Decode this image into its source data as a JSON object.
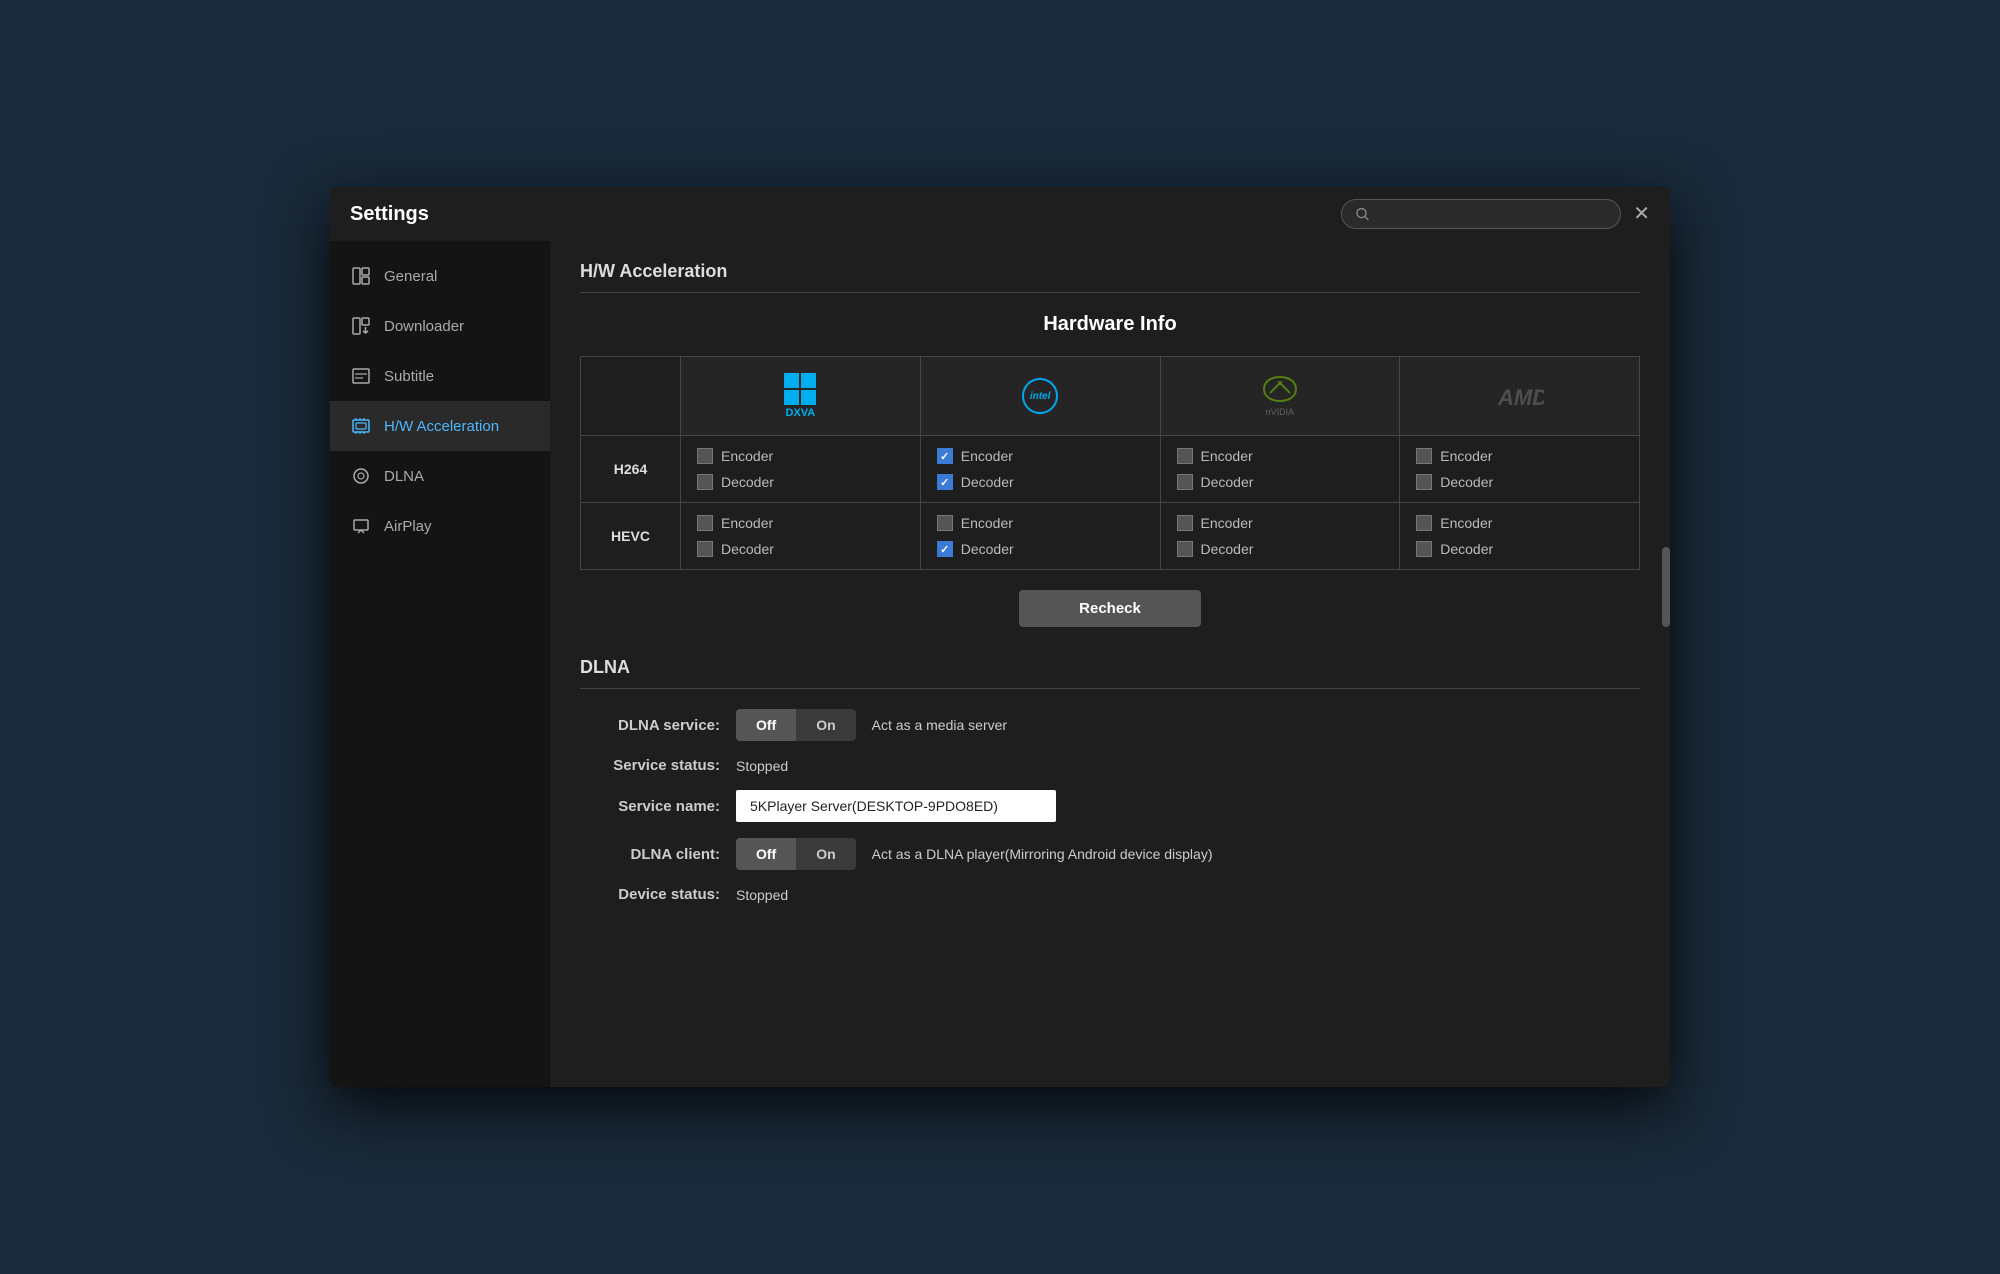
{
  "window": {
    "title": "Settings",
    "close_label": "✕"
  },
  "search": {
    "placeholder": ""
  },
  "sidebar": {
    "items": [
      {
        "id": "general",
        "label": "General",
        "icon": "⊞"
      },
      {
        "id": "downloader",
        "label": "Downloader",
        "icon": "⬇"
      },
      {
        "id": "subtitle",
        "label": "Subtitle",
        "icon": "≡"
      },
      {
        "id": "hw-acceleration",
        "label": "H/W Acceleration",
        "icon": "⊡",
        "active": true
      },
      {
        "id": "dlna",
        "label": "DLNA",
        "icon": "◎"
      },
      {
        "id": "airplay",
        "label": "AirPlay",
        "icon": "▲"
      }
    ]
  },
  "hw_section": {
    "heading": "H/W Acceleration",
    "hardware_info_title": "Hardware Info",
    "columns": [
      "DXVA",
      "Intel",
      "NVIDIA",
      "AMD"
    ],
    "rows": [
      {
        "label": "H264",
        "cells": [
          {
            "encoder": false,
            "decoder": false
          },
          {
            "encoder": true,
            "decoder": true
          },
          {
            "encoder": false,
            "decoder": false
          },
          {
            "encoder": false,
            "decoder": false
          }
        ]
      },
      {
        "label": "HEVC",
        "cells": [
          {
            "encoder": false,
            "decoder": false
          },
          {
            "encoder": false,
            "decoder": true
          },
          {
            "encoder": false,
            "decoder": false
          },
          {
            "encoder": false,
            "decoder": false
          }
        ]
      }
    ],
    "encoder_label": "Encoder",
    "decoder_label": "Decoder",
    "recheck_label": "Recheck"
  },
  "dlna_section": {
    "heading": "DLNA",
    "service_label": "DLNA service:",
    "off_label": "Off",
    "on_label": "On",
    "service_desc": "Act as a media server",
    "service_status_label": "Service status:",
    "service_status_value": "Stopped",
    "service_name_label": "Service name:",
    "service_name_value": "5KPlayer Server(DESKTOP-9PDO8ED)",
    "client_label": "DLNA client:",
    "client_off_label": "Off",
    "client_on_label": "On",
    "client_desc": "Act as a DLNA player(Mirroring Android device display)",
    "device_status_label": "Device status:",
    "device_status_value": "Stopped"
  }
}
